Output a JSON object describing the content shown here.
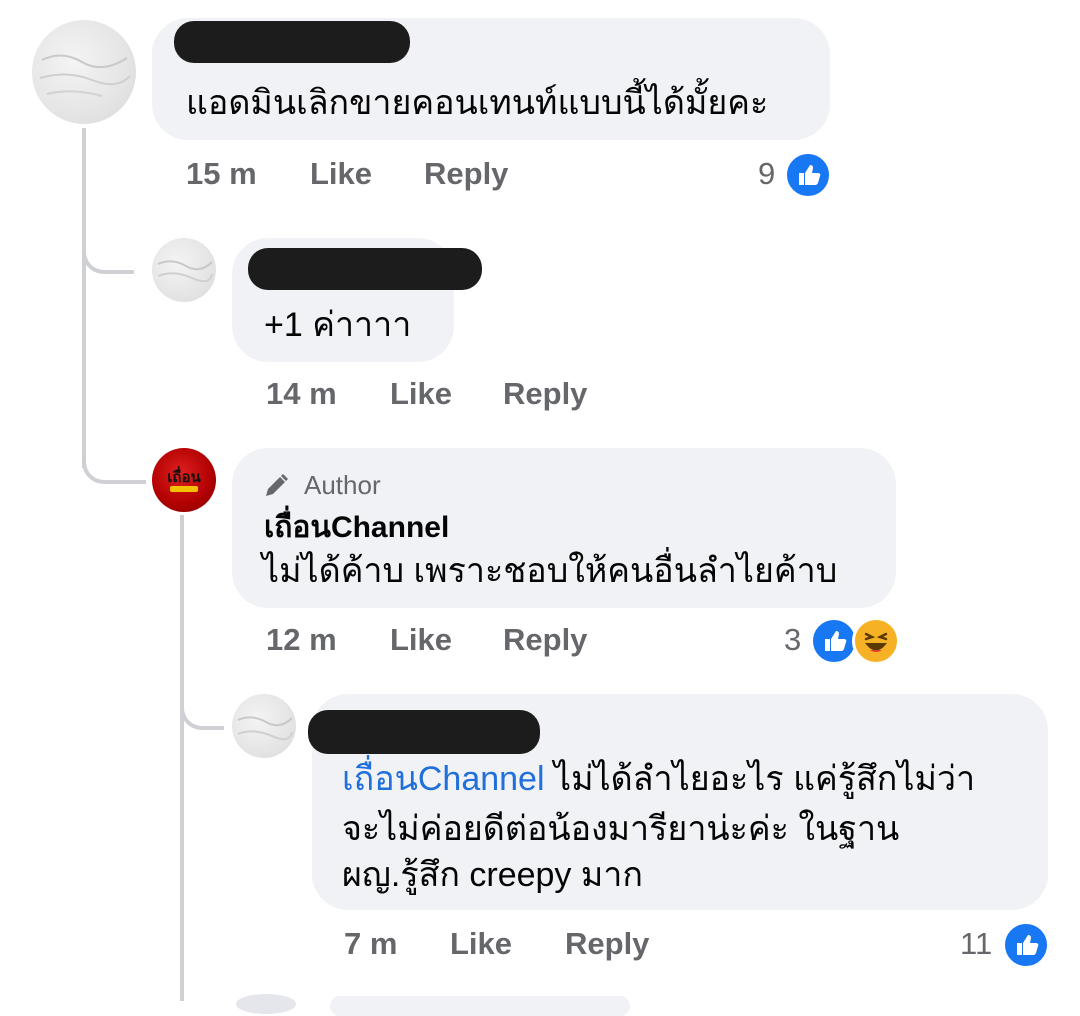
{
  "comments": [
    {
      "text": "แอดมินเลิกขายคอนเทนท์แบบนี้ได้มั้ยคะ",
      "time": "15 m",
      "like_label": "Like",
      "reply_label": "Reply",
      "reaction_count": "9",
      "reactions": [
        "like-icon"
      ]
    },
    {
      "text": "+1 ค่าาาา",
      "time": "14 m",
      "like_label": "Like",
      "reply_label": "Reply"
    },
    {
      "author_badge": "Author",
      "name": "เถื่อนChannel",
      "text": "ไม่ได้ค้าบ เพราะชอบให้คนอื่นลำไยค้าบ",
      "time": "12 m",
      "like_label": "Like",
      "reply_label": "Reply",
      "reaction_count": "3",
      "reactions": [
        "like-icon",
        "haha-icon"
      ],
      "avatar_text": "เถื่อน"
    },
    {
      "mention": "เถื่อนChannel",
      "line1": " ไม่ได้ลำไยอะไร แค่รู้สึกไม่ว่า",
      "line2": "จะไม่ค่อยดีต่อน้องมารียาน่ะค่ะ ในฐาน",
      "line3": "ผญ.รู้สึก creepy มาก",
      "time": "7 m",
      "like_label": "Like",
      "reply_label": "Reply",
      "reaction_count": "11",
      "reactions": [
        "like-icon"
      ]
    }
  ],
  "colors": {
    "bubble": "#f0f2f5",
    "meta": "#65676b",
    "mention": "#216fdb",
    "like": "#1877f2",
    "haha": "#f7b125",
    "thread": "#ced0d4"
  }
}
